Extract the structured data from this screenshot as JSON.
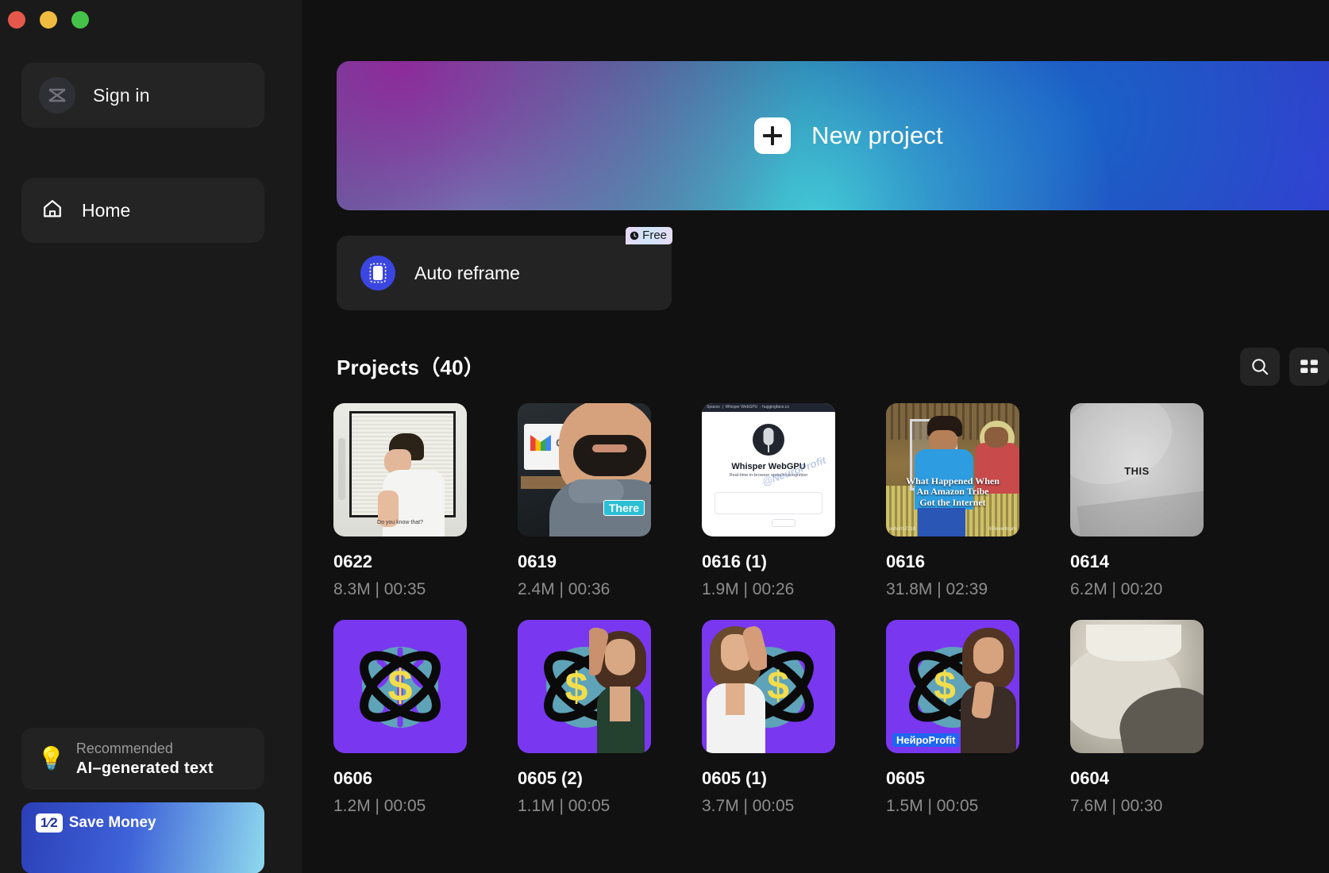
{
  "window": {
    "controls": [
      "close",
      "minimize",
      "zoom"
    ]
  },
  "sidebar": {
    "signin": {
      "label": "Sign in",
      "icon": "capcut-logo-icon"
    },
    "nav": [
      {
        "label": "Home",
        "icon": "home-icon",
        "selected": true
      }
    ],
    "recommended": {
      "eyebrow": "Recommended",
      "title": "AI–generated text",
      "icon": "lightbulb-icon"
    },
    "promo": {
      "chip": "1⁄2",
      "text": "Save Money"
    }
  },
  "hero": {
    "label": "New project",
    "icon": "plus-icon"
  },
  "tools": {
    "reframe": {
      "label": "Auto reframe",
      "badge": "Free",
      "badge_icon": "clock-icon",
      "icon": "reframe-icon"
    }
  },
  "projects": {
    "heading": "Projects（40）",
    "count": 40,
    "actions": [
      {
        "name": "search",
        "icon": "search-icon"
      },
      {
        "name": "layout",
        "icon": "grid-view-icon"
      }
    ],
    "items": [
      {
        "title": "0622",
        "meta": "8.3M | 00:35",
        "size": "8.3M",
        "duration": "00:35",
        "thumb": {
          "kind": "photo-man-whiteboard",
          "caption": "Do you know that?"
        }
      },
      {
        "title": "0619",
        "meta": "2.4M | 00:36",
        "size": "2.4M",
        "duration": "00:36",
        "thumb": {
          "kind": "photo-man-gmail",
          "caption": "There",
          "screen_text": "Gm"
        }
      },
      {
        "title": "0616 (1)",
        "meta": "1.9M | 00:26",
        "size": "1.9M",
        "duration": "00:26",
        "thumb": {
          "kind": "screenshot-browser",
          "title": "Whisper WebGPU",
          "subtitle": "Real-time in-browser speech recognition",
          "watermark": "@NeuroProfit"
        }
      },
      {
        "title": "0616",
        "meta": "31.8M | 02:39",
        "size": "31.8M",
        "duration": "02:39",
        "thumb": {
          "kind": "photo-tribe",
          "caption": "What Happened When\nAn Amazon Tribe\nGot the Internet",
          "tag_left": "ushorts7218",
          "tag_right": "IIEIeventcom"
        }
      },
      {
        "title": "0614",
        "meta": "6.2M | 00:20",
        "size": "6.2M",
        "duration": "00:20",
        "thumb": {
          "kind": "photo-shirt",
          "caption": "THIS"
        }
      },
      {
        "title": "0606",
        "meta": "1.2M | 00:05",
        "size": "1.2M",
        "duration": "00:05",
        "thumb": {
          "kind": "brain-logo"
        }
      },
      {
        "title": "0605 (2)",
        "meta": "1.1M | 00:05",
        "size": "1.1M",
        "duration": "00:05",
        "thumb": {
          "kind": "brain-logo-person",
          "person_side": "right"
        }
      },
      {
        "title": "0605 (1)",
        "meta": "3.7M | 00:05",
        "size": "3.7M",
        "duration": "00:05",
        "thumb": {
          "kind": "brain-logo-person",
          "person_side": "left"
        }
      },
      {
        "title": "0605",
        "meta": "1.5M | 00:05",
        "size": "1.5M",
        "duration": "00:05",
        "thumb": {
          "kind": "brain-logo-person",
          "person_side": "right",
          "tag": "НейроProfit"
        }
      },
      {
        "title": "0604",
        "meta": "7.6M | 00:30",
        "size": "7.6M",
        "duration": "00:30",
        "thumb": {
          "kind": "photo-mouse"
        }
      }
    ]
  },
  "colors": {
    "app_background": "#111111",
    "sidebar_background": "#1a1a1a",
    "card_background": "#242424",
    "accent_blue": "#3b46e0",
    "brand_purple": "#7a37f0",
    "text_primary": "#ffffff",
    "text_secondary": "#8d8d8d"
  }
}
